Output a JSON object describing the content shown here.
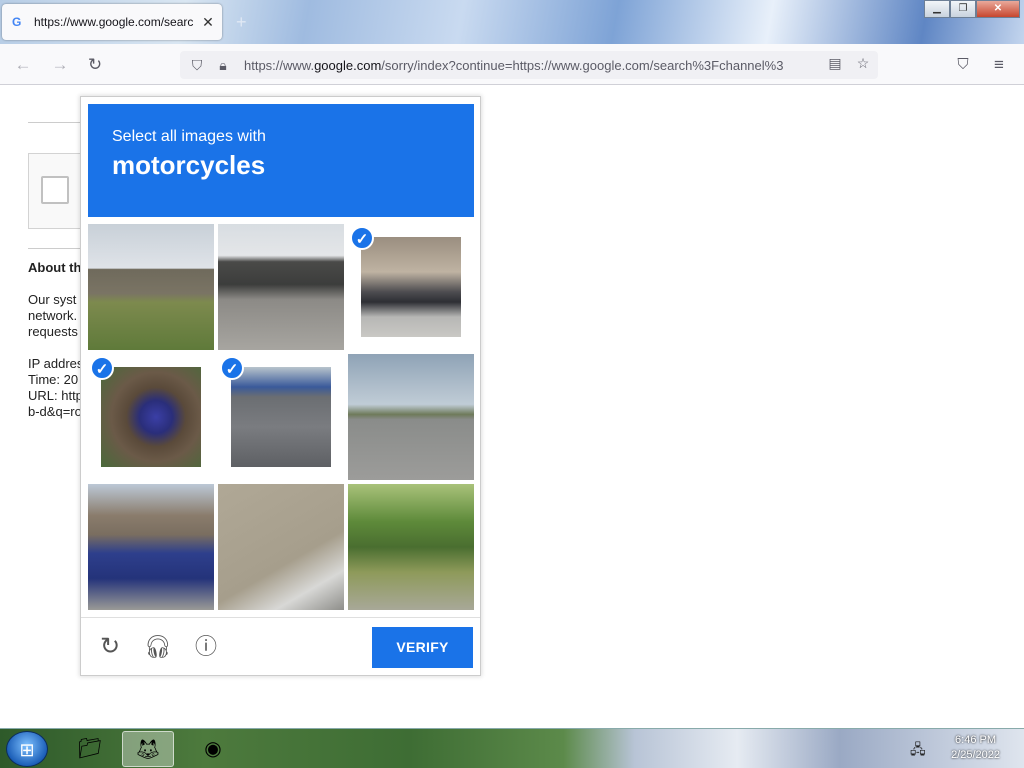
{
  "browser": {
    "tab_title": "https://www.google.com/searc",
    "tab_favicon": "G",
    "tab_close": "✕",
    "new_tab": "+",
    "url_prefix": "https://www.",
    "url_domain": "google.com",
    "url_rest": "/sorry/index?continue=https://www.google.com/search%3Fchannel%3",
    "icons": [
      "back-icon",
      "forward-icon",
      "reload-icon",
      "shield-icon",
      "lock-icon",
      "reader-view-icon",
      "bookmark-star-icon",
      "pocket-icon",
      "menu-icon"
    ]
  },
  "page": {
    "about_heading": "About th",
    "body_lines": [
      "Our syst",
      "network.",
      "requests"
    ],
    "info_lines": [
      "IP addres",
      "Time: 20",
      "URL: http",
      "b-d&q=ro"
    ]
  },
  "captcha": {
    "instruction": "Select all images with",
    "target": "motorcycles",
    "verify_label": "VERIFY",
    "tiles": [
      {
        "name": "overpass-field",
        "selected": false
      },
      {
        "name": "street-bridge-cars",
        "selected": false
      },
      {
        "name": "parked-motorcycles-street",
        "selected": true
      },
      {
        "name": "dirt-bike",
        "selected": true
      },
      {
        "name": "motorcyclist-road",
        "selected": true
      },
      {
        "name": "highway-truck-distance",
        "selected": false
      },
      {
        "name": "blue-semi-truck",
        "selected": false
      },
      {
        "name": "pavement-closeup",
        "selected": false
      },
      {
        "name": "trees-parked-car",
        "selected": false
      }
    ],
    "accent_color": "#1a73e8"
  },
  "taskbar": {
    "time": "6:46 PM",
    "date": "2/25/2022"
  }
}
